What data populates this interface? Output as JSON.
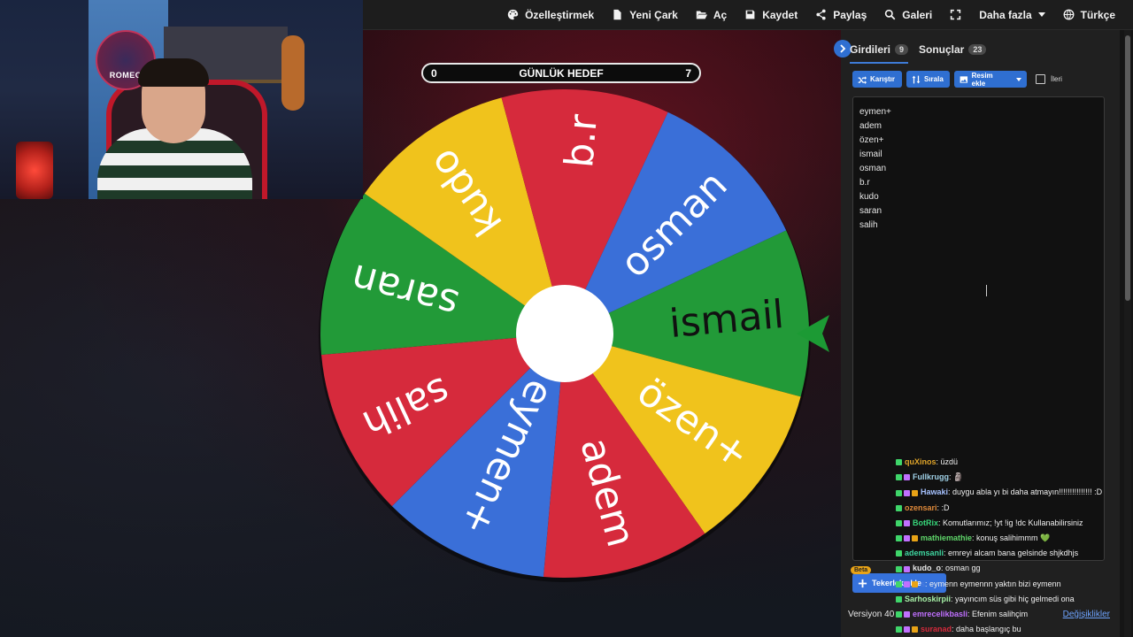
{
  "topbar": {
    "items": [
      {
        "label": "Özelleştirmek",
        "icon": "palette-icon"
      },
      {
        "label": "Yeni Çark",
        "icon": "new-file-icon"
      },
      {
        "label": "Aç",
        "icon": "folder-open-icon"
      },
      {
        "label": "Kaydet",
        "icon": "save-icon"
      },
      {
        "label": "Paylaş",
        "icon": "share-icon"
      },
      {
        "label": "Galeri",
        "icon": "search-icon"
      },
      {
        "label": "",
        "icon": "fullscreen-icon"
      },
      {
        "label": "Daha fazla",
        "icon": "chevron-down-icon"
      },
      {
        "label": "Türkçe",
        "icon": "globe-icon"
      }
    ]
  },
  "webcam": {
    "logo_text": "ROMEO"
  },
  "goal": {
    "left_value": "0",
    "title": "GÜNLÜK HEDEF",
    "right_value": "7"
  },
  "wheel": {
    "segments": [
      {
        "label": "ismail",
        "color": "#229a38"
      },
      {
        "label": "özen+",
        "color": "#f0c31c"
      },
      {
        "label": "adem",
        "color": "#d62a3c"
      },
      {
        "label": "eymen+",
        "color": "#3a6fd8"
      },
      {
        "label": "salih",
        "color": "#d62a3c"
      },
      {
        "label": "saran",
        "color": "#229a38"
      },
      {
        "label": "kudo",
        "color": "#f0c31c"
      },
      {
        "label": "b.r",
        "color": "#d62a3c"
      },
      {
        "label": "osman",
        "color": "#3a6fd8"
      }
    ],
    "pointer_color": "#1c9a34",
    "center_color": "#ffffff"
  },
  "panel": {
    "tabs": {
      "entries_label": "Girdileri",
      "entries_count": "9",
      "results_label": "Sonuçlar",
      "results_count": "23"
    },
    "toolbar": {
      "shuffle": "Karıştır",
      "sort": "Sırala",
      "add_image": "Resim ekle",
      "advanced": "İleri"
    },
    "entries": [
      "eymen+",
      "adem",
      "özen+",
      "ismail",
      "osman",
      "b.r",
      "kudo",
      "saran",
      "salih"
    ],
    "beta": "Beta",
    "add_wheel": "Tekerlek ekle",
    "version": "Versiyon 40",
    "changes": "Değişiklikler"
  },
  "chat": [
    {
      "user": "quXinos",
      "color": "#e0a52a",
      "msg": ": üzdü"
    },
    {
      "user": "Fullkrugg",
      "color": "#9fd0e6",
      "msg": ": 🗿"
    },
    {
      "user": "Hawaki",
      "color": "#a6c2ff",
      "msg": ": duygu abla yı bi daha atmayın!!!!!!!!!!!!!!! :D"
    },
    {
      "user": "ozensari",
      "color": "#e08a3a",
      "msg": ": :D"
    },
    {
      "user": "BotRix",
      "color": "#37d67a",
      "msg": ": Komutlarımız; !yt !ig !dc Kullanabilirsiniz"
    },
    {
      "user": "mathiemathie",
      "color": "#5fd66a",
      "msg": ": konuş salihimmm 💚"
    },
    {
      "user": "ademsanli",
      "color": "#3fd6a0",
      "msg": ": emreyi alcam bana gelsinde shjkdhjs"
    },
    {
      "user": "kudo_o",
      "color": "#e6e6e6",
      "msg": ": osman gg"
    },
    {
      "user": "s",
      "color": "#4a7be0",
      "msg": ": eymenn eymennn yaktın bizi eymenn"
    },
    {
      "user": "Sarhoskirpii",
      "color": "#a6f0a6",
      "msg": ": yayıncım süs gibi hiç gelmedi ona"
    },
    {
      "user": "emrecelikbasli",
      "color": "#c070ff",
      "msg": ": Efenim salihçim"
    },
    {
      "user": "suranad",
      "color": "#d62a3c",
      "msg": ": daha başlangıç bu"
    }
  ]
}
